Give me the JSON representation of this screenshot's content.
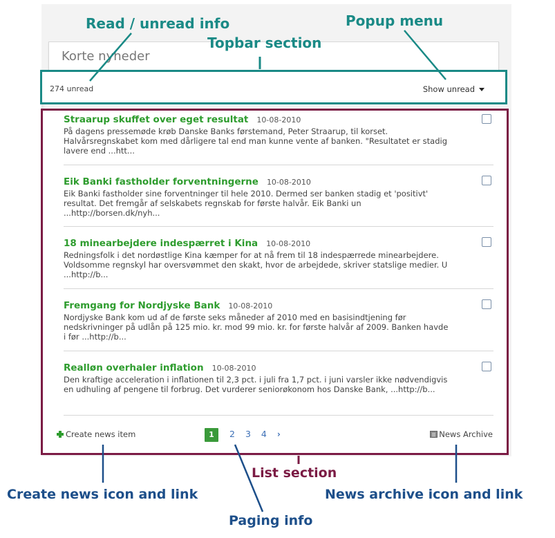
{
  "widget": {
    "title": "Korte nyheder",
    "unread_count": "274 unread",
    "popup_menu_label": "Show unread"
  },
  "news_items": [
    {
      "title": "Straarup skuffet over eget resultat",
      "date": "10-08-2010",
      "body": "På dagens pressemøde krøb Danske Banks førstemand, Peter Straarup, til korset. Halvårsregnskabet kom med dårligere tal end man kunne vente af banken. \"Resultatet er stadig lavere end ...htt..."
    },
    {
      "title": "Eik Banki fastholder forventningerne",
      "date": "10-08-2010",
      "body": "Eik Banki fastholder sine forventninger til hele 2010. Dermed ser banken stadig et 'positivt' resultat. Det fremgår af selskabets regnskab for første halvår. Eik Banki un ...http://borsen.dk/nyh..."
    },
    {
      "title": "18 minearbejdere indespærret i Kina",
      "date": "10-08-2010",
      "body": "Redningsfolk i det nordøstlige Kina kæmper for at nå frem til 18 indespærrede minearbejdere. Voldsomme regnskyl har oversvømmet den skakt, hvor de arbejdede, skriver statslige medier. U ...http://b..."
    },
    {
      "title": "Fremgang for Nordjyske Bank",
      "date": "10-08-2010",
      "body": "Nordjyske Bank kom ud af de første seks måneder af 2010 med en basisindtjening før nedskrivninger på udlån på 125 mio. kr. mod 99 mio. kr. for første halvår af 2009. Banken havde i før ...http://b..."
    },
    {
      "title": "Realløn overhaler inflation",
      "date": "10-08-2010",
      "body": "Den kraftige acceleration i inflationen til 2,3 pct. i juli fra 1,7 pct. i juni varsler ikke nødvendigvis en udhuling af pengene til forbrug. Det vurderer seniorøkonom hos Danske Bank, ...http://b..."
    }
  ],
  "footer": {
    "create_label": "Create news item",
    "pages": [
      "1",
      "2",
      "3",
      "4"
    ],
    "active_page": "1",
    "next_label": "›",
    "archive_label": "News Archive"
  },
  "annotations": {
    "read_unread": "Read / unread info",
    "popup_menu": "Popup menu",
    "topbar_section": "Topbar section",
    "list_section": "List section",
    "create_news": "Create news icon and link",
    "paging_info": "Paging info",
    "news_archive": "News archive icon and link"
  },
  "colors": {
    "topbar_outline": "#1a8a86",
    "list_outline": "#7b1b44",
    "annotation_blue": "#1d4f8a",
    "news_title_green": "#2e9c2e"
  }
}
